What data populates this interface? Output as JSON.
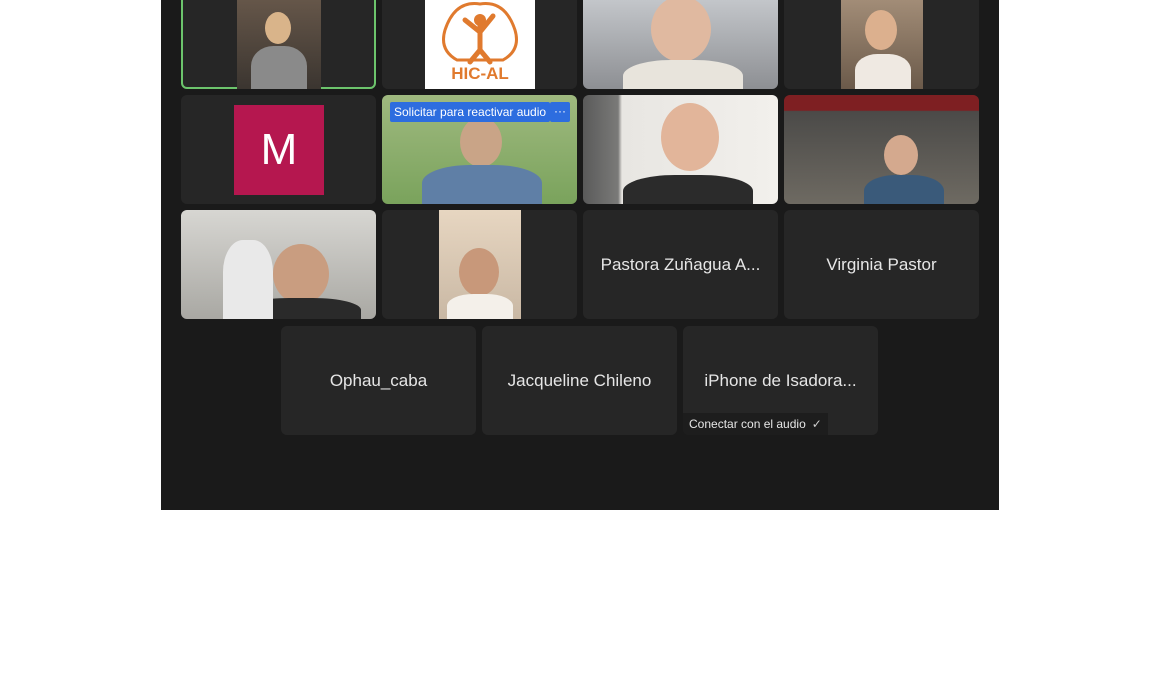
{
  "tiles": {
    "logo_text": "HIC-AL",
    "avatar_initial": "M",
    "unmute_request": "Solicitar para reactivar audio",
    "more_options": "···",
    "pastora": "Pastora Zuñagua A...",
    "virginia": "Virginia Pastor",
    "ophau": "Ophau_caba",
    "jacqueline": "Jacqueline Chileno",
    "isadora": "iPhone de Isadora...",
    "connect_audio": "Conectar con el audio",
    "check_icon": "✓"
  },
  "colors": {
    "meeting_bg": "#1a1a1a",
    "tile_bg": "#262626",
    "active_speaker": "#6cc46c",
    "avatar_m": "#b5174f",
    "notice_blue": "#2d6ddf",
    "hic_orange": "#e07a2e"
  }
}
